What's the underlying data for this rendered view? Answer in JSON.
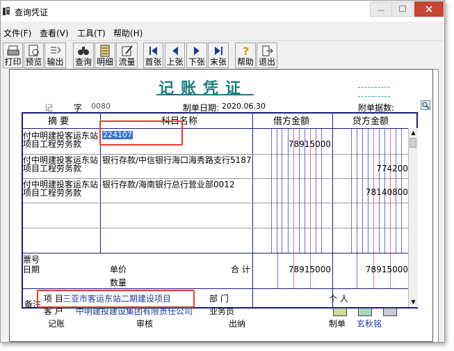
{
  "window": {
    "title": "查询凭证"
  },
  "menu": [
    "文件(F)",
    "查看(V)",
    "工具(T)",
    "帮助(H)"
  ],
  "toolbar": {
    "print": "打印",
    "preview": "预览",
    "export": "输出",
    "query": "查询",
    "detail": "明细",
    "flow": "流量",
    "first": "首张",
    "prev": "上张",
    "next": "下张",
    "last": "末张",
    "help": "帮助",
    "exit": "退出"
  },
  "voucher": {
    "title": "记账凭证",
    "type_label": "记",
    "number_label": "字",
    "number": "0080",
    "date_label": "制单日期:",
    "date": "2020.06.30",
    "attachments_label": "附单据数:",
    "columns": {
      "summary": "摘 要",
      "account": "科目名称",
      "debit": "借方金额",
      "credit": "贷方金额"
    },
    "rows": [
      {
        "summary_l1": "付中明建投客运东站",
        "summary_l2": "项目工程劳务款",
        "account": "224107",
        "debit": "78915000",
        "credit": ""
      },
      {
        "summary_l1": "付中明建投客运东站",
        "summary_l2": "项目工程劳务款",
        "account": "银行存款/中信银行海口海秀路支行5187",
        "debit": "",
        "credit": "774200"
      },
      {
        "summary_l1": "付中明建投客运东站",
        "summary_l2": "项目工程劳务款",
        "account": "银行存款/海南银行总行营业部0012",
        "debit": "",
        "credit": "78140800"
      }
    ],
    "bill_no_label": "票号",
    "date2_label": "日期",
    "unit_price_label": "单价",
    "quantity_label": "数量",
    "total_label": "合 计",
    "total_debit": "78915000",
    "total_credit": "78915000",
    "remark_label": "备注",
    "project_label": "项 目",
    "project_value": "三亚市客运东站二期建设项目",
    "dept_label": "部 门",
    "person_label": "个 人",
    "customer_label": "客 户",
    "customer_value": "中明建投建设集团有限责任公司",
    "salesman_label": "业务员",
    "bookkeeper_label": "记账",
    "auditor_label": "审核",
    "cashier_label": "出纳",
    "maker_label": "制单",
    "maker_value": "玄秋铭"
  },
  "colors": {
    "teal": "#1a7f7f",
    "grid": "#1a1a80",
    "highlight": "#e23a2a",
    "selection": "#3876c8"
  }
}
